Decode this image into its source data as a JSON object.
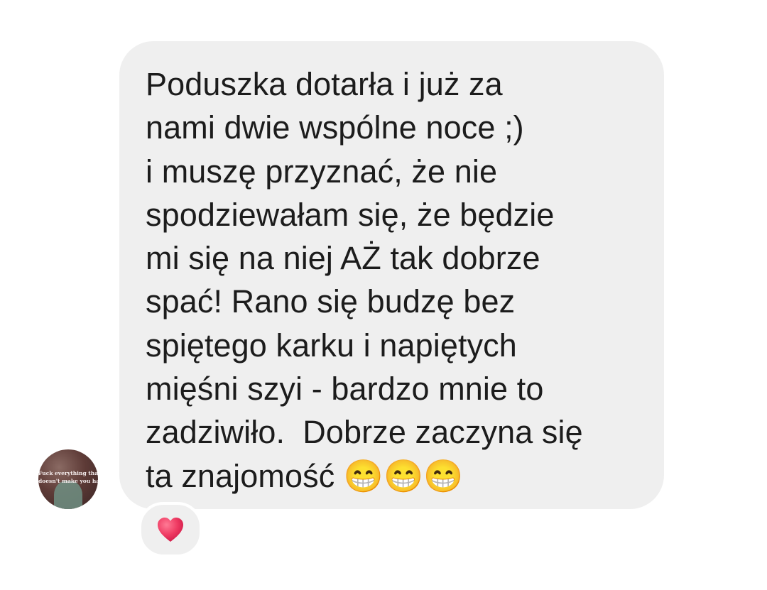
{
  "message": {
    "lines": [
      "Poduszka dotarła i już za",
      "nami dwie wspólne noce ;)",
      "i muszę przyznać, że nie",
      "spodziewałam się, że będzie",
      "mi się na niej AŻ tak dobrze",
      "spać! Rano się budzę bez",
      "spiętego karku i napiętych",
      "mięśni szyi - bardzo mnie to",
      "zadziwiło.  Dobrze zaczyna się",
      "ta znajomość 😁😁😁"
    ],
    "bubble_color": "#efefef",
    "text_color": "#1c1c1c"
  },
  "avatar": {
    "text": "Fuck everything that\ndoesn't make you happy"
  },
  "reaction": {
    "icon": "heart-icon",
    "color": "#e8345a"
  }
}
